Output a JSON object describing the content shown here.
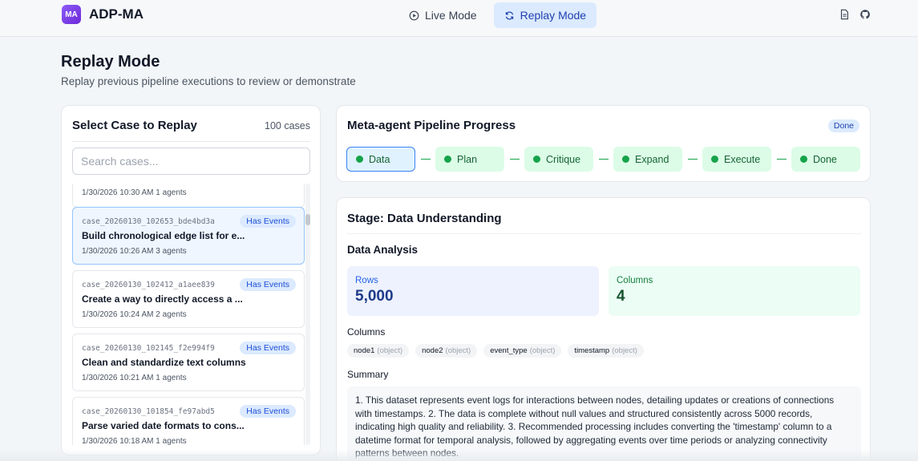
{
  "app": {
    "logo_text": "MA",
    "name": "ADP-MA"
  },
  "modes": [
    {
      "label": "Live Mode",
      "icon": "play-circle-icon",
      "active": false
    },
    {
      "label": "Replay Mode",
      "icon": "refresh-icon",
      "active": true
    }
  ],
  "header_icons": [
    "document-icon",
    "github-icon"
  ],
  "page": {
    "title": "Replay Mode",
    "subtitle": "Replay previous pipeline executions to review or demonstrate"
  },
  "case_panel": {
    "title": "Select Case to Replay",
    "count": "100 cases",
    "search_placeholder": "Search cases...",
    "partial_item_meta": "1/30/2026 10:30 AM   1 agents",
    "cases": [
      {
        "id": "case_20260130_102653_bde4bd3a",
        "badge": "Has Events",
        "title": "Build chronological edge list for e...",
        "meta": "1/30/2026 10:26 AM   3 agents",
        "selected": true
      },
      {
        "id": "case_20260130_102412_a1aee839",
        "badge": "Has Events",
        "title": "Create a way to directly access a ...",
        "meta": "1/30/2026 10:24 AM   2 agents",
        "selected": false
      },
      {
        "id": "case_20260130_102145_f2e994f9",
        "badge": "Has Events",
        "title": "Clean and standardize text columns",
        "meta": "1/30/2026 10:21 AM   1 agents",
        "selected": false
      },
      {
        "id": "case_20260130_101854_fe97abd5",
        "badge": "Has Events",
        "title": "Parse varied date formats to cons...",
        "meta": "1/30/2026 10:18 AM   1 agents",
        "selected": false
      }
    ]
  },
  "pipeline": {
    "title": "Meta-agent Pipeline Progress",
    "status": "Done",
    "stages": [
      "Data",
      "Plan",
      "Critique",
      "Expand",
      "Execute",
      "Done"
    ],
    "current_stage": "Data"
  },
  "detail": {
    "stage_title": "Stage: Data Understanding",
    "section_title": "Data Analysis",
    "rows_label": "Rows",
    "rows_value": "5,000",
    "columns_label": "Columns",
    "columns_value": "4",
    "columns_heading": "Columns",
    "columns": [
      {
        "name": "node1",
        "type": "(object)"
      },
      {
        "name": "node2",
        "type": "(object)"
      },
      {
        "name": "event_type",
        "type": "(object)"
      },
      {
        "name": "timestamp",
        "type": "(object)"
      }
    ],
    "summary_heading": "Summary",
    "summary_text": "1. This dataset represents event logs for interactions between nodes, detailing updates or creations of connections with timestamps. 2. The data is complete without null values and structured consistently across 5000 records, indicating high quality and reliability. 3. Recommended processing includes converting the 'timestamp' column to a datetime format for temporal analysis, followed by aggregating events over time periods or analyzing connectivity patterns between nodes."
  },
  "colors": {
    "accent": "#3b82f6",
    "success": "#16a34a",
    "brand": "#7c3aed"
  }
}
